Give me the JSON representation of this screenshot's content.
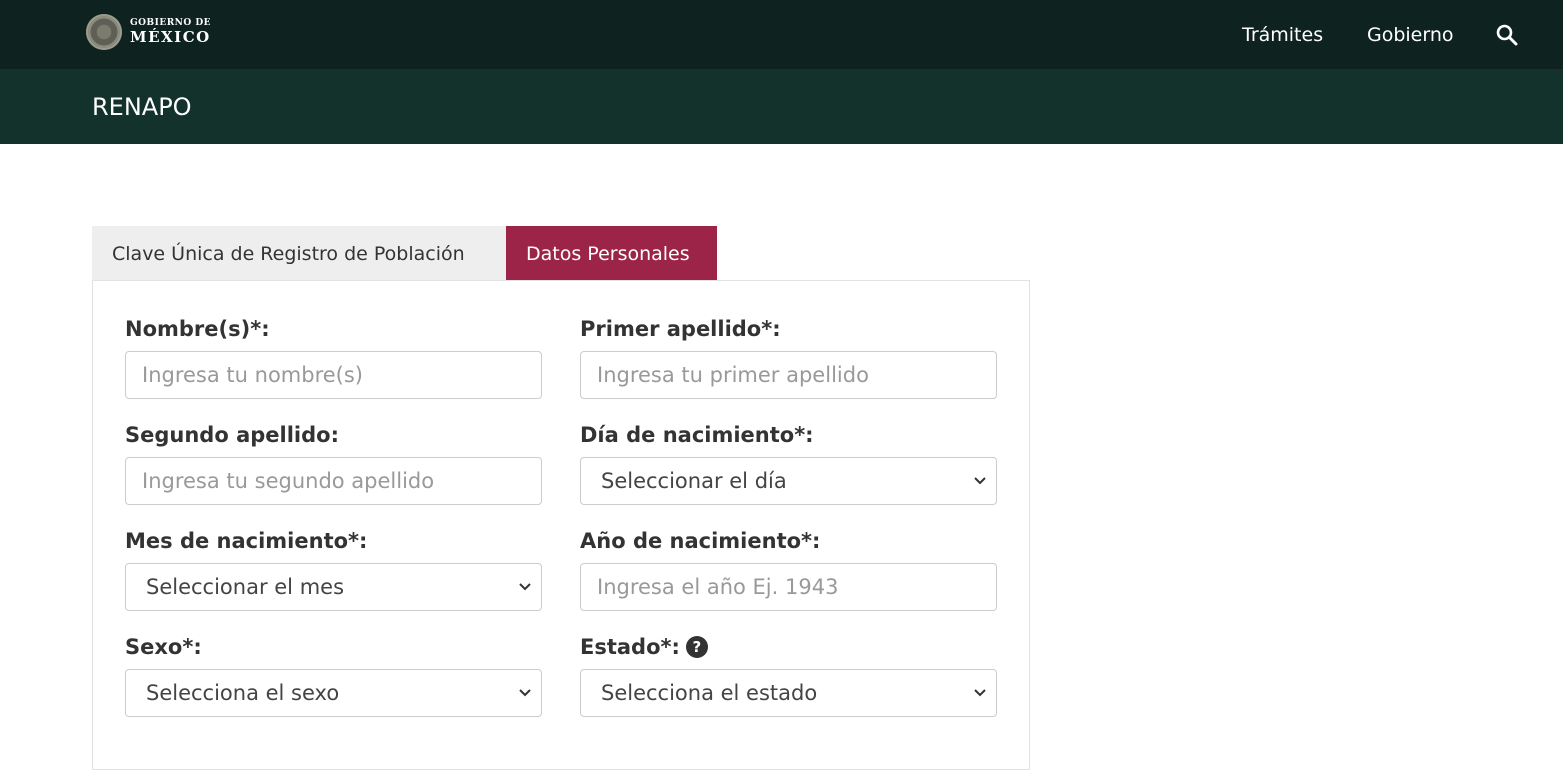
{
  "header": {
    "logo_line1": "GOBIERNO DE",
    "logo_line2": "MÉXICO",
    "nav": {
      "tramites": "Trámites",
      "gobierno": "Gobierno"
    },
    "search_icon": "magnifier-icon"
  },
  "subheader": {
    "title": "RENAPO"
  },
  "tabs": [
    {
      "label": "Clave Única de Registro de Población",
      "active": false
    },
    {
      "label": "Datos Personales",
      "active": true
    }
  ],
  "form": {
    "nombre": {
      "label": "Nombre(s)*:",
      "placeholder": "Ingresa tu nombre(s)"
    },
    "primer_apellido": {
      "label": "Primer apellido*:",
      "placeholder": "Ingresa tu primer apellido"
    },
    "segundo_apellido": {
      "label": "Segundo apellido:",
      "placeholder": "Ingresa tu segundo apellido"
    },
    "dia": {
      "label": "Día de nacimiento*:",
      "value": "Seleccionar el día"
    },
    "mes": {
      "label": "Mes de nacimiento*:",
      "value": "Seleccionar el mes"
    },
    "anio": {
      "label": "Año de nacimiento*:",
      "placeholder": "Ingresa el año Ej. 1943"
    },
    "sexo": {
      "label": "Sexo*:",
      "value": "Selecciona el sexo"
    },
    "estado": {
      "label": "Estado*:",
      "value": "Selecciona el estado",
      "help_icon": "question-circle-icon"
    }
  },
  "colors": {
    "topbar": "#0e2220",
    "subbar": "#13322b",
    "active_tab": "#9d2449",
    "inactive_tab": "#eeeeee"
  }
}
